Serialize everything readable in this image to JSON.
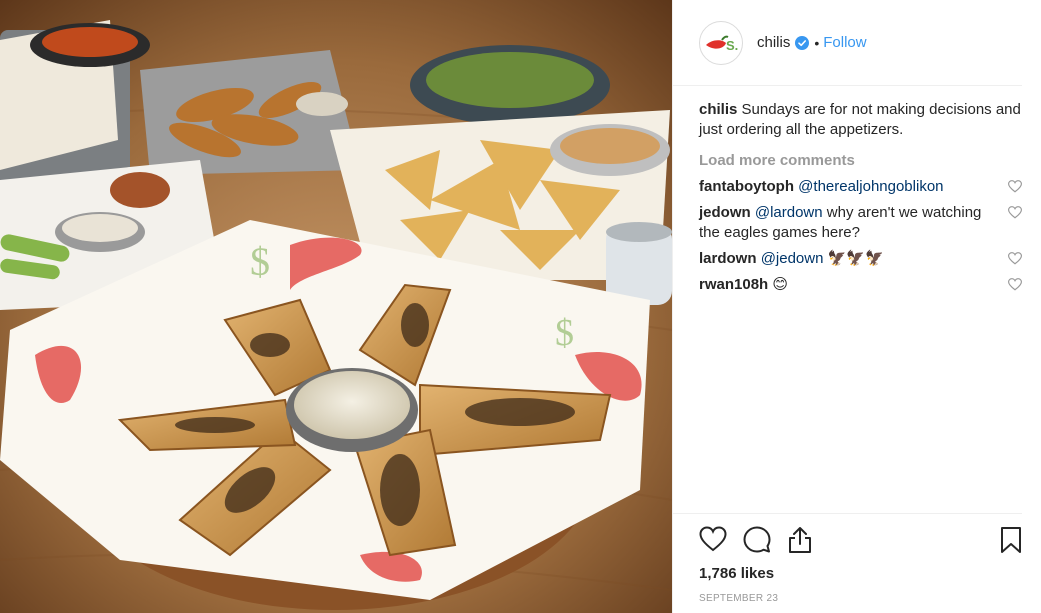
{
  "post": {
    "username": "chilis",
    "follow_label": "Follow",
    "dot": "•",
    "caption_user": "chilis",
    "caption_text": "Sundays are for not making decisions and just ordering all the appetizers.",
    "load_more_label": "Load more comments",
    "comments": [
      {
        "user": "fantaboytoph",
        "text": "@therealjohngoblikon"
      },
      {
        "user": "jedown",
        "mention": "@lardown",
        "text": "why aren't we watching the eagles games here?"
      },
      {
        "user": "lardown",
        "mention": "@jedown",
        "text": "🦅🦅🦅"
      },
      {
        "user": "rwan108h",
        "text": "😊"
      }
    ],
    "likes": "1,786 likes",
    "date": "SEPTEMBER 23"
  },
  "icons": {
    "verified": "verified-badge-icon",
    "like": "heart-icon",
    "comment": "comment-icon",
    "share": "share-icon",
    "save": "bookmark-icon",
    "comment_like": "heart-icon"
  },
  "colors": {
    "accent": "#3897f0",
    "brand_red": "#e0312b",
    "brand_green": "#6aa84f",
    "muted": "#999999",
    "mention": "#003569"
  }
}
